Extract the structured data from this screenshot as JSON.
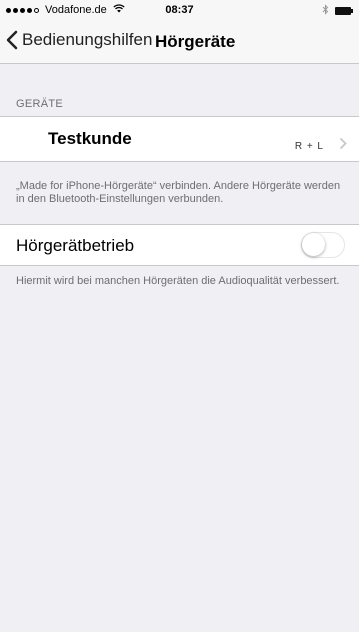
{
  "statusbar": {
    "carrier": "Vodafone.de",
    "time": "08:37",
    "signal_bars": 4
  },
  "navbar": {
    "back_label": "Bedienungshilfen",
    "title": "Hörgeräte"
  },
  "devices_section": {
    "header": "GERÄTE",
    "items": [
      {
        "name": "Testkunde",
        "detail": "R + L"
      }
    ],
    "footer": "„Made for iPhone-Hörgeräte“ verbinden. Andere Hörgeräte werden in den Bluetooth-Einstellungen verbunden."
  },
  "mode_section": {
    "label": "Hörgerätbetrieb",
    "enabled": false,
    "footer": "Hiermit wird bei manchen Hörgeräten die Audioqualität verbessert."
  },
  "icons": {
    "back": "chevron-left-icon",
    "row_disclosure": "chevron-right-icon",
    "wifi": "wifi-icon",
    "bluetooth": "bluetooth-icon",
    "battery": "battery-icon"
  }
}
